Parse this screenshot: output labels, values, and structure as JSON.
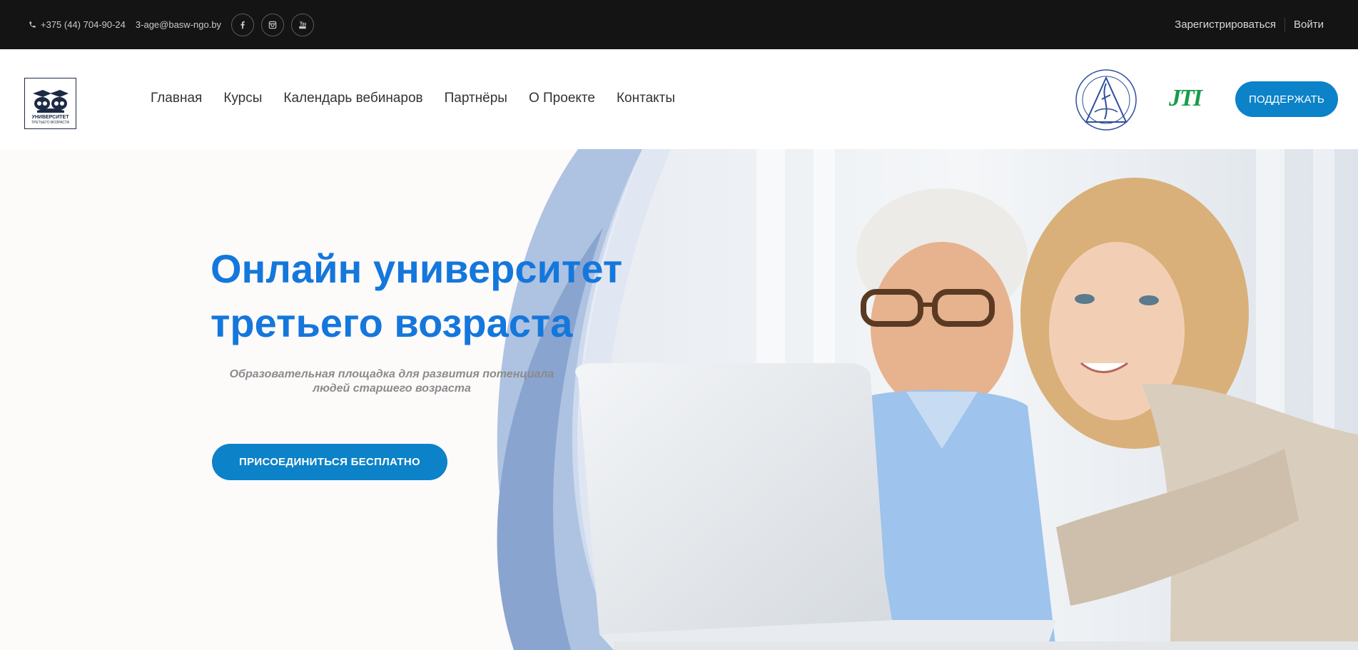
{
  "topbar": {
    "phone": "+375 (44) 704-90-24",
    "email": "3-age@basw-ngo.by",
    "social": [
      "facebook-icon",
      "instagram-icon",
      "youtube-icon"
    ],
    "register_label": "Зарегистрироваться",
    "login_label": "Войти"
  },
  "header": {
    "logo": {
      "line1": "УНИВЕРСИТЕТ",
      "line2": "ТРЕТЬЕГО ВОЗРАСТА"
    },
    "nav": [
      "Главная",
      "Курсы",
      "Календарь вебинаров",
      "Партнёры",
      "О Проекте",
      "Контакты"
    ],
    "partner_jti": "JTI",
    "support_label": "ПОДДЕРЖАТЬ"
  },
  "hero": {
    "title_line1": "Онлайн университет",
    "title_line2": "третьего возраста",
    "subtitle_line1": "Образовательная площадка для развития потенциала",
    "subtitle_line2": "людей старшего возраста",
    "cta_label": "ПРИСОЕДИНИТЬСЯ БЕСПЛАТНО"
  },
  "colors": {
    "topbar_bg": "#141414",
    "accent_blue": "#0c82c8",
    "title_blue": "#1477dc",
    "jti_green": "#1a9c4b"
  }
}
